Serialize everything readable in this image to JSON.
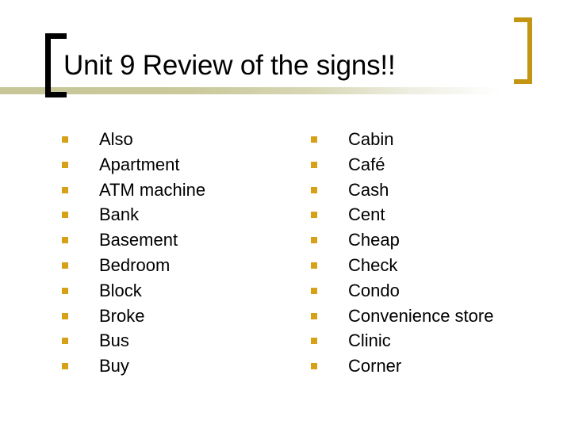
{
  "slide": {
    "title": "Unit 9 Review of the signs!!",
    "background_color": "#ffffff",
    "accent_color": "#d6a017",
    "rule_color": "#c6c697",
    "bracket_left_color": "#000000",
    "bracket_right_color": "#c39512",
    "text_color": "#000000",
    "bullet_glyph": "square-bullet"
  },
  "columns": {
    "left": {
      "items": [
        {
          "label": "Also"
        },
        {
          "label": "Apartment"
        },
        {
          "label": "ATM machine"
        },
        {
          "label": "Bank"
        },
        {
          "label": "Basement"
        },
        {
          "label": "Bedroom"
        },
        {
          "label": "Block"
        },
        {
          "label": "Broke"
        },
        {
          "label": "Bus"
        },
        {
          "label": "Buy"
        }
      ]
    },
    "right": {
      "items": [
        {
          "label": "Cabin"
        },
        {
          "label": "Café"
        },
        {
          "label": "Cash"
        },
        {
          "label": "Cent"
        },
        {
          "label": "Cheap"
        },
        {
          "label": "Check"
        },
        {
          "label": "Condo"
        },
        {
          "label": "Convenience store"
        },
        {
          "label": "Clinic"
        },
        {
          "label": "Corner"
        }
      ]
    }
  }
}
